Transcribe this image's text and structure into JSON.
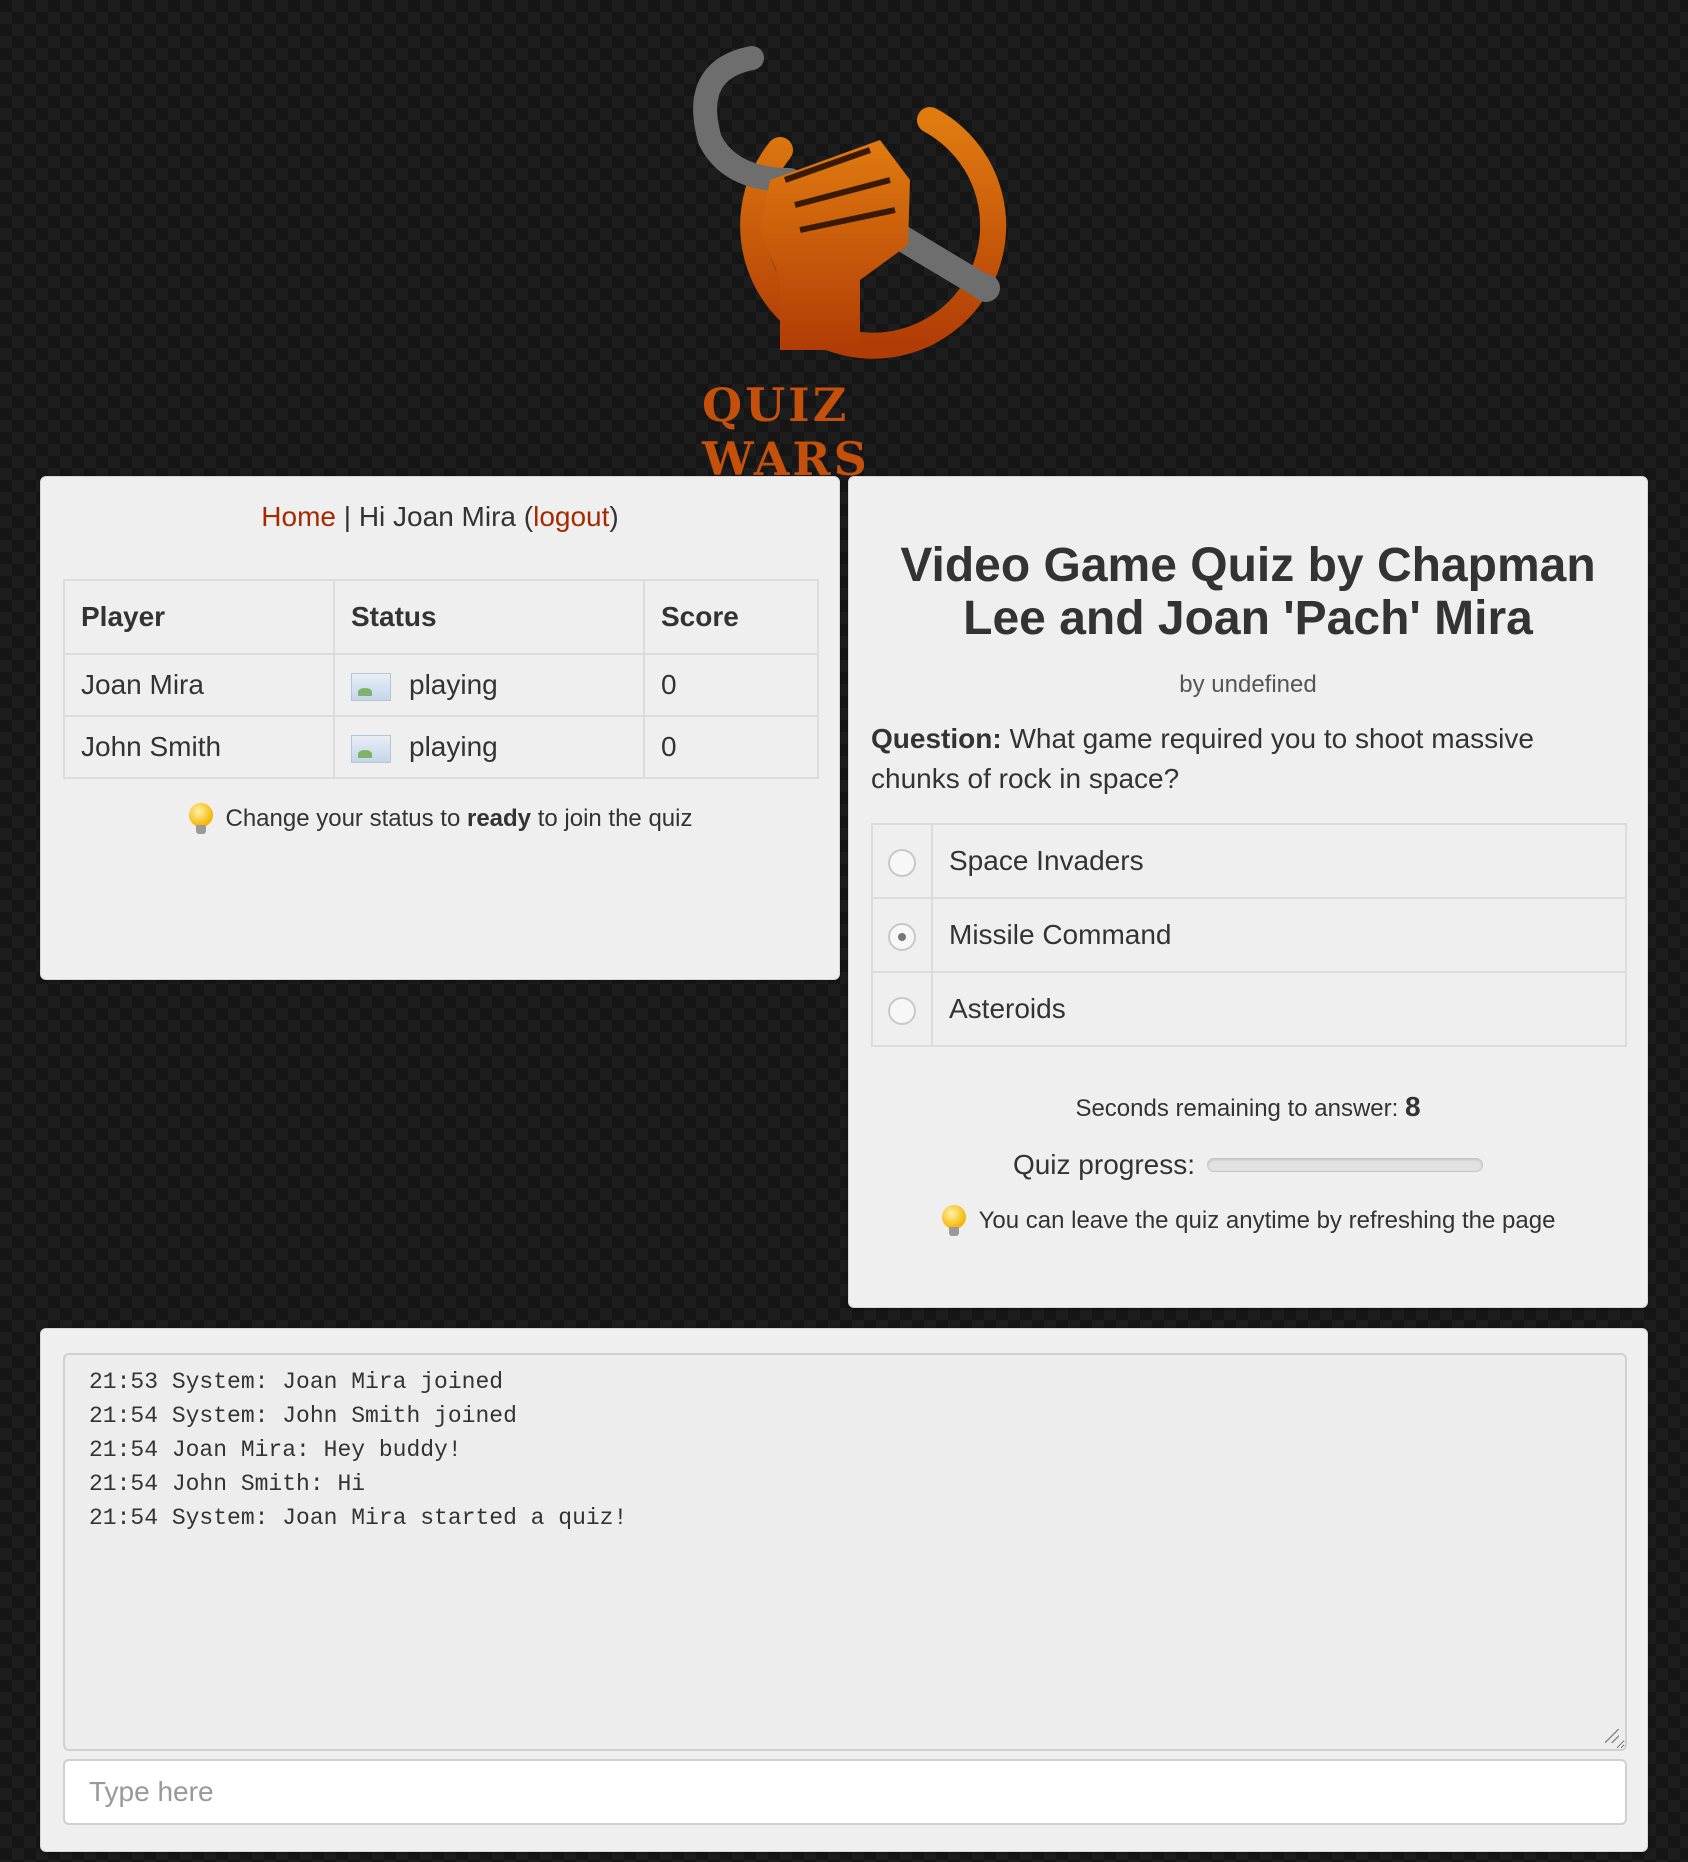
{
  "brand": {
    "logo_text": "QUIZ WARS"
  },
  "nav": {
    "home": "Home",
    "separator": " | ",
    "greeting": "Hi Joan Mira (",
    "logout": "logout",
    "close_paren": ")"
  },
  "players_table": {
    "headers": [
      "Player",
      "Status",
      "Score"
    ],
    "rows": [
      {
        "player": "Joan Mira",
        "status": "playing",
        "score": "0"
      },
      {
        "player": "John Smith",
        "status": "playing",
        "score": "0"
      }
    ]
  },
  "status_hint": {
    "before": "Change your status to ",
    "bold": "ready",
    "after": " to join the quiz"
  },
  "quiz": {
    "title": "Video Game Quiz by Chapman Lee and Joan 'Pach' Mira",
    "byline": "by undefined",
    "question_label": "Question:",
    "question_text": " What game required you to shoot massive chunks of rock in space?",
    "options": [
      {
        "label": "Space Invaders",
        "selected": false
      },
      {
        "label": "Missile Command",
        "selected": true
      },
      {
        "label": "Asteroids",
        "selected": false
      }
    ],
    "timer_label": "Seconds remaining to answer: ",
    "timer_value": "8",
    "progress_label": "Quiz progress:",
    "progress_fraction": 0,
    "leave_hint": "You can leave the quiz anytime by refreshing the page"
  },
  "chat": {
    "messages": [
      "21:53 System: Joan Mira joined",
      "21:54 System: John Smith joined",
      "21:54 Joan Mira: Hey buddy!",
      "21:54 John Smith: Hi",
      "21:54 System: Joan Mira started a quiz!"
    ],
    "input_placeholder": "Type here"
  },
  "colors": {
    "accent": "#a52a00",
    "logo_orange": "#d4650f",
    "logo_gray": "#6e6e6e"
  }
}
